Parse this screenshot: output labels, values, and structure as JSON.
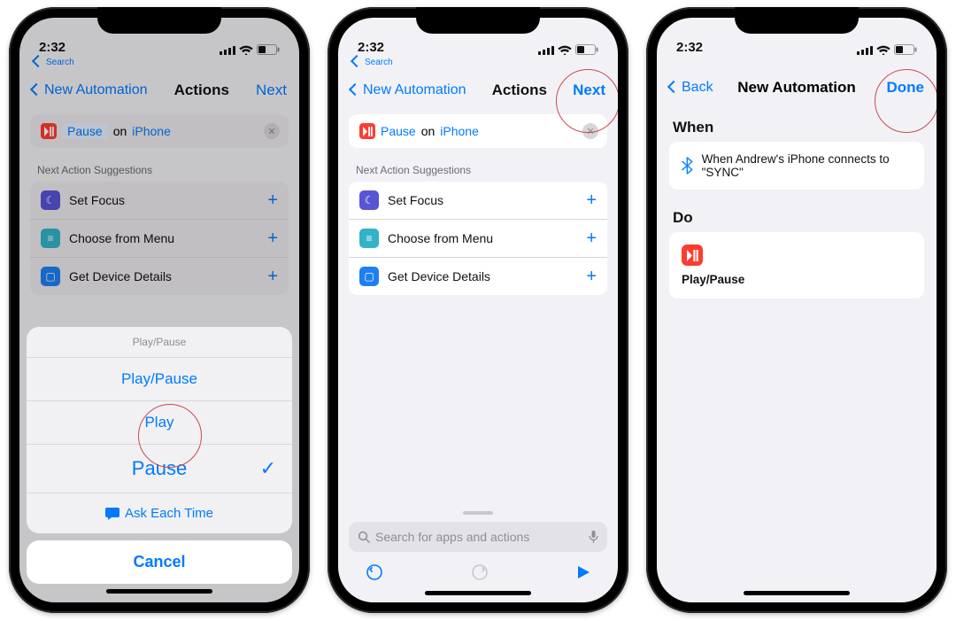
{
  "status": {
    "time": "2:32",
    "breadcrumb": "Search"
  },
  "nav1": {
    "back": "New Automation",
    "title": "Actions",
    "next": "Next"
  },
  "nav2": {
    "back": "New Automation",
    "title": "Actions",
    "next": "Next"
  },
  "nav3": {
    "back": "Back",
    "title": "New Automation",
    "next": "Done"
  },
  "pill": {
    "token": "Pause",
    "on": "on",
    "device": "iPhone"
  },
  "suggest_header": "Next Action Suggestions",
  "suggestions": {
    "0": {
      "label": "Set Focus"
    },
    "1": {
      "label": "Choose from Menu"
    },
    "2": {
      "label": "Get Device Details"
    }
  },
  "sheet": {
    "head": "Play/Pause",
    "r0": "Play/Pause",
    "r1": "Play",
    "r2": "Pause",
    "ask": "Ask Each Time",
    "cancel": "Cancel"
  },
  "search_placeholder": "Search for apps and actions",
  "p3": {
    "when_h": "When",
    "when_text": "When Andrew's iPhone connects to \"SYNC\"",
    "do_h": "Do",
    "do_label": "Play/Pause"
  }
}
